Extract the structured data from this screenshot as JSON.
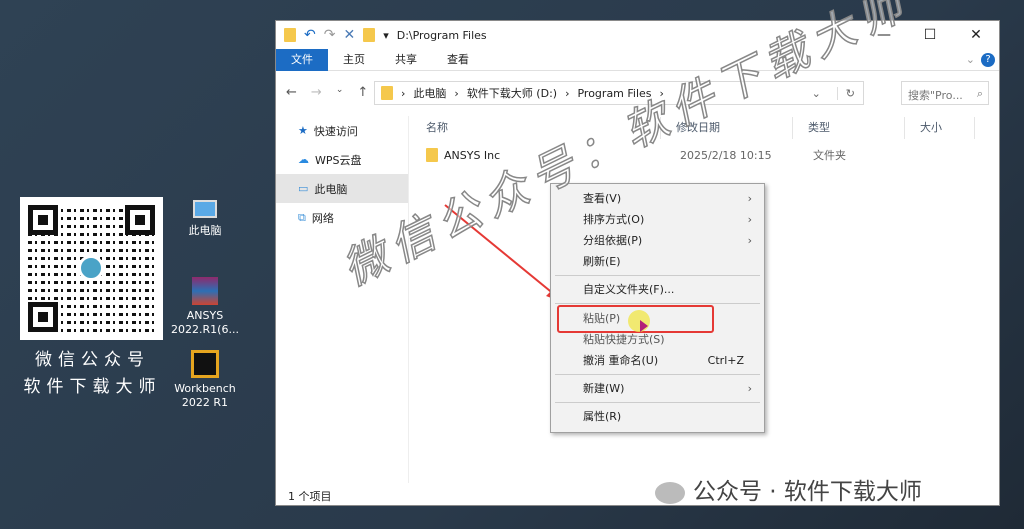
{
  "desktop": {
    "qr_caption": [
      "微信公众号",
      "软件下载大师"
    ],
    "icons": [
      {
        "label": "此电脑"
      },
      {
        "label": "ANSYS 2022.R1(6..."
      },
      {
        "label": "Workbench 2022 R1"
      }
    ]
  },
  "window": {
    "title": "D:\\Program Files",
    "ribbon_tabs": [
      "文件",
      "主页",
      "共享",
      "查看"
    ],
    "breadcrumb": [
      "此电脑",
      "软件下载大师 (D:)",
      "Program Files"
    ],
    "search_placeholder": "搜索\"Pro...",
    "nav": [
      "快速访问",
      "WPS云盘",
      "此电脑",
      "网络"
    ],
    "columns": [
      "名称",
      "修改日期",
      "类型",
      "大小"
    ],
    "files": [
      {
        "name": "ANSYS Inc",
        "date": "2025/2/18 10:15",
        "type": "文件夹"
      }
    ],
    "status": "1 个项目"
  },
  "context_menu": {
    "items": [
      {
        "label": "查看(V)",
        "submenu": true
      },
      {
        "label": "排序方式(O)",
        "submenu": true
      },
      {
        "label": "分组依据(P)",
        "submenu": true
      },
      {
        "label": "刷新(E)"
      },
      {
        "label": "自定义文件夹(F)..."
      },
      {
        "label": "粘贴(P)",
        "highlighted": true
      },
      {
        "label": "粘贴快捷方式(S)"
      },
      {
        "label": "撤消 重命名(U)",
        "shortcut": "Ctrl+Z"
      },
      {
        "label": "新建(W)",
        "submenu": true
      },
      {
        "label": "属性(R)"
      }
    ]
  },
  "watermark": {
    "diagonal": "微信公众号：软件下载大师",
    "bottom": "公众号 · 软件下载大师"
  },
  "colors": {
    "accent": "#1c6cc4",
    "highlight": "#e53935"
  }
}
